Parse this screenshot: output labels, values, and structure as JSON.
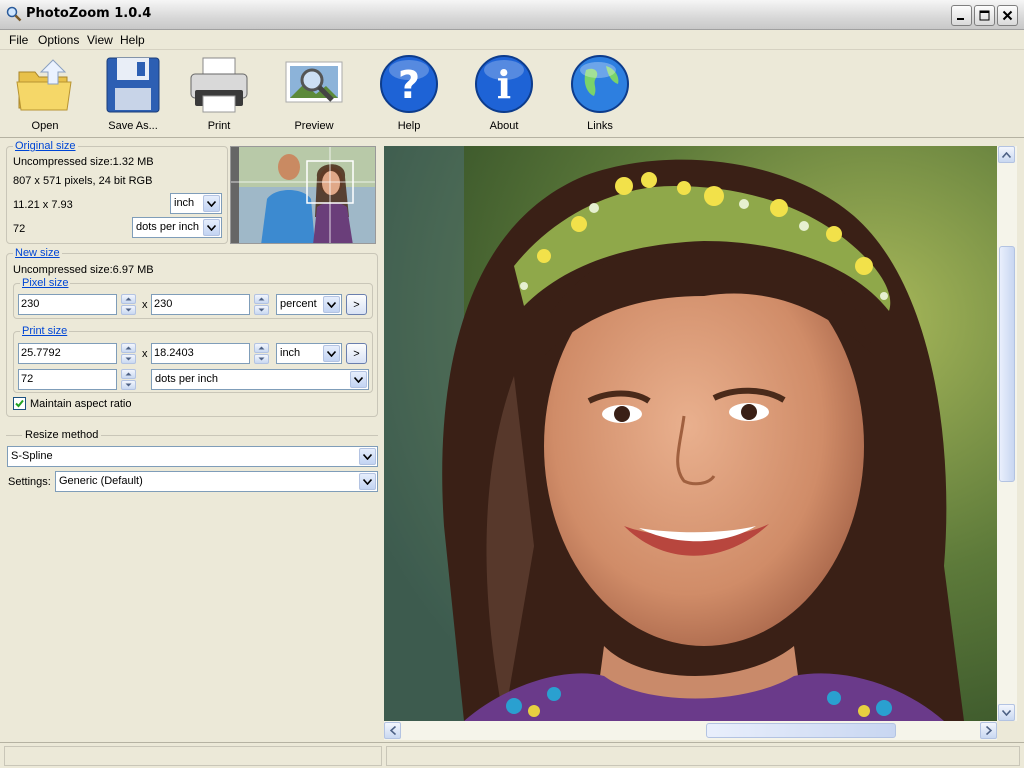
{
  "window": {
    "title": "PhotoZoom 1.0.4"
  },
  "menu": [
    "File",
    "Options",
    "View",
    "Help"
  ],
  "toolbar": [
    {
      "label": "Open",
      "icon": "folder-open-icon"
    },
    {
      "label": "Save As...",
      "icon": "floppy-disk-icon"
    },
    {
      "label": "Print",
      "icon": "printer-icon"
    },
    {
      "label": "Preview",
      "icon": "magnifier-preview-icon"
    },
    {
      "label": "Help",
      "icon": "question-icon"
    },
    {
      "label": "About",
      "icon": "info-icon"
    },
    {
      "label": "Links",
      "icon": "globe-icon"
    }
  ],
  "original": {
    "legend": "Original size",
    "uncompressed": "Uncompressed size:1.32 MB",
    "dimensions": "807 x 571 pixels, 24 bit RGB",
    "print_size": "11.21 x 7.93",
    "unit": "inch",
    "resolution": "72",
    "res_unit": "dots per inch"
  },
  "newsize": {
    "legend": "New size",
    "uncompressed": "Uncompressed size:6.97 MB",
    "pixel": {
      "legend": "Pixel size",
      "width": "230",
      "height": "230",
      "x": "x",
      "unit": "percent",
      "go": ">"
    },
    "print": {
      "legend": "Print size",
      "width": "25.7792",
      "height": "18.2403",
      "x": "x",
      "unit": "inch",
      "go": ">",
      "resolution": "72",
      "res_unit": "dots per inch"
    },
    "aspect_label": "Maintain aspect ratio",
    "aspect_checked": true
  },
  "resize": {
    "legend": "Resize method",
    "method": "S-Spline",
    "settings_label": "Settings:",
    "settings_value": "Generic (Default)"
  }
}
